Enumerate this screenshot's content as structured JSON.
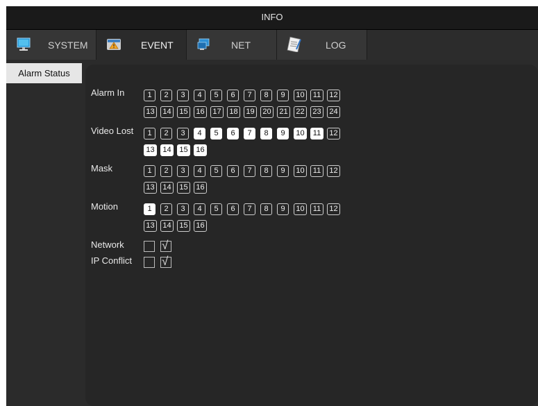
{
  "window": {
    "title": "INFO"
  },
  "tabs": [
    {
      "label": "SYSTEM",
      "icon": "monitor-icon",
      "active": false
    },
    {
      "label": "EVENT",
      "icon": "warning-icon",
      "active": true
    },
    {
      "label": "NET",
      "icon": "network-icon",
      "active": false
    },
    {
      "label": "LOG",
      "icon": "log-notepad-icon",
      "active": false
    }
  ],
  "sidebar": {
    "items": [
      {
        "label": "Alarm Status",
        "selected": true
      }
    ]
  },
  "status": {
    "alarm_in": {
      "label": "Alarm In",
      "channels": [
        "1",
        "2",
        "3",
        "4",
        "5",
        "6",
        "7",
        "8",
        "9",
        "10",
        "11",
        "12",
        "13",
        "14",
        "15",
        "16",
        "17",
        "18",
        "19",
        "20",
        "21",
        "22",
        "23",
        "24"
      ],
      "active": []
    },
    "video_lost": {
      "label": "Video Lost",
      "channels": [
        "1",
        "2",
        "3",
        "4",
        "5",
        "6",
        "7",
        "8",
        "9",
        "10",
        "11",
        "12",
        "13",
        "14",
        "15",
        "16"
      ],
      "active": [
        "4",
        "5",
        "6",
        "7",
        "8",
        "9",
        "10",
        "11",
        "13",
        "14",
        "15",
        "16"
      ]
    },
    "mask": {
      "label": "Mask",
      "channels": [
        "1",
        "2",
        "3",
        "4",
        "5",
        "6",
        "7",
        "8",
        "9",
        "10",
        "11",
        "12",
        "13",
        "14",
        "15",
        "16"
      ],
      "active": []
    },
    "motion": {
      "label": "Motion",
      "channels": [
        "1",
        "2",
        "3",
        "4",
        "5",
        "6",
        "7",
        "8",
        "9",
        "10",
        "11",
        "12",
        "13",
        "14",
        "15",
        "16"
      ],
      "active": [
        "1"
      ]
    },
    "network": {
      "label": "Network",
      "boxes": [
        false,
        true
      ]
    },
    "ip_conflict": {
      "label": "IP Conflict",
      "boxes": [
        false,
        true
      ]
    }
  },
  "colors": {
    "background": "#2b2b2b",
    "panel": "#262626",
    "active_cell": "#ffffff",
    "titlebar": "#1a1a1a"
  }
}
